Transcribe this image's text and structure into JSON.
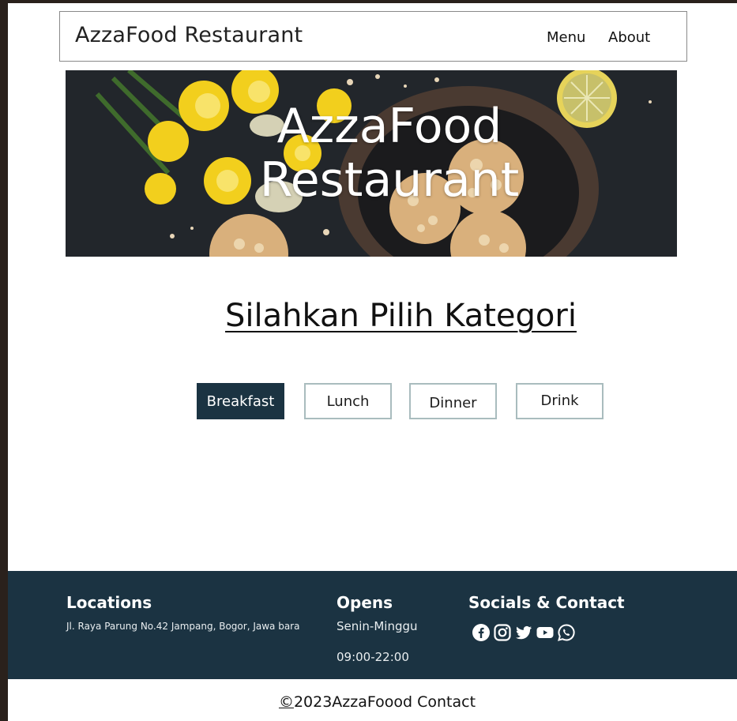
{
  "navbar": {
    "brand": "AzzaFood Restaurant",
    "links": [
      {
        "label": "Menu"
      },
      {
        "label": "About"
      }
    ]
  },
  "hero": {
    "title_line1": "AzzaFood",
    "title_line2": "Restaurant"
  },
  "main": {
    "heading": "Silahkan Pilih Kategori",
    "categories": [
      {
        "label": "Breakfast",
        "active": true
      },
      {
        "label": "Lunch",
        "active": false
      },
      {
        "label": "Dinner",
        "active": false
      },
      {
        "label": "Drink",
        "active": false
      }
    ]
  },
  "footer": {
    "locations_heading": "Locations",
    "address": "Jl. Raya Parung No.42 Jampang, Bogor, Jawa bara",
    "opens_heading": "Opens",
    "days": "Senin-Minggu",
    "hours": "09:00-22:00",
    "socials_heading": "Socials & Contact",
    "social_icons": [
      "facebook-icon",
      "instagram-icon",
      "twitter-icon",
      "youtube-icon",
      "whatsapp-icon"
    ]
  },
  "copyright": {
    "symbol": "©",
    "text": "2023AzzaFoood Contact"
  },
  "colors": {
    "primary": "#1b3342",
    "button_border": "#a9bcbe",
    "page_bg": "#ffffff",
    "frame_bg": "#2a211c"
  }
}
